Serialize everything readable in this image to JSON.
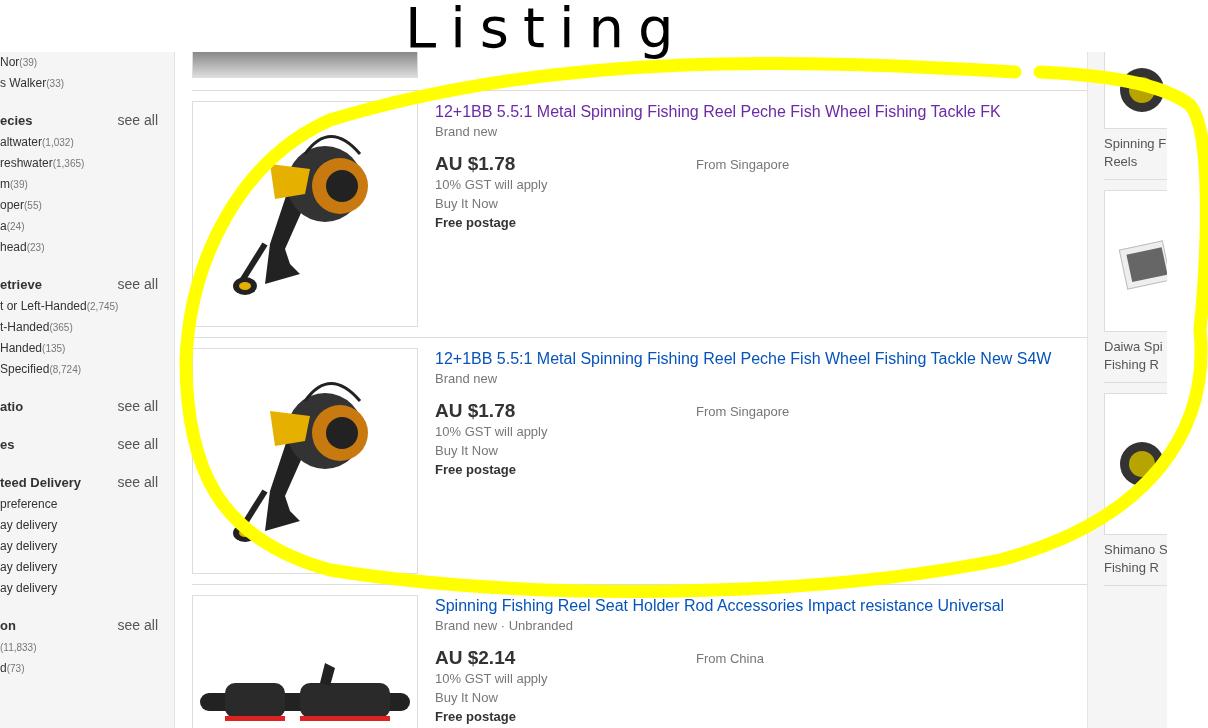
{
  "annotation": {
    "label": "Listing"
  },
  "sidebar": {
    "groups": [
      {
        "items": [
          {
            "name": "Nor",
            "count": "(39)"
          },
          {
            "name": "s Walker",
            "count": "(33)"
          }
        ]
      },
      {
        "heading": "ecies",
        "see_all": "see all",
        "items": [
          {
            "name": "altwater",
            "count": "(1,032)"
          },
          {
            "name": "reshwater",
            "count": "(1,365)"
          },
          {
            "name": "m",
            "count": "(39)"
          },
          {
            "name": "oper",
            "count": "(55)"
          },
          {
            "name": "a",
            "count": "(24)"
          },
          {
            "name": "head",
            "count": "(23)"
          }
        ]
      },
      {
        "heading": "etrieve",
        "see_all": "see all",
        "items": [
          {
            "name": "t or Left-Handed",
            "count": "(2,745)"
          },
          {
            "name": "t-Handed",
            "count": "(365)"
          },
          {
            "name": "Handed",
            "count": "(135)"
          },
          {
            "name": "Specified",
            "count": "(8,724)"
          }
        ]
      },
      {
        "heading": "atio",
        "see_all": "see all"
      },
      {
        "heading": "es",
        "see_all": "see all"
      },
      {
        "heading": "teed Delivery",
        "see_all": "see all",
        "items": [
          {
            "name": "preference"
          },
          {
            "name": "ay delivery"
          },
          {
            "name": "ay delivery"
          },
          {
            "name": "ay delivery"
          },
          {
            "name": "ay delivery"
          }
        ]
      },
      {
        "heading": "on",
        "see_all": "see all",
        "items": [
          {
            "count": "(11,833)"
          },
          {
            "name": "d",
            "count": "(73)"
          }
        ]
      }
    ]
  },
  "listings": [
    {
      "kind": "reel",
      "title": "12+1BB 5.5:1 Metal Spinning Fishing Reel Peche Fish Wheel Fishing Tackle FK",
      "visited": true,
      "condition": "Brand new",
      "price": "AU $1.78",
      "gst": "10% GST will apply",
      "format": "Buy It Now",
      "postage": "Free postage",
      "location": "From Singapore"
    },
    {
      "kind": "reel",
      "title": "12+1BB 5.5:1 Metal Spinning Fishing Reel Peche Fish Wheel Fishing Tackle New S4W",
      "visited": false,
      "condition": "Brand new",
      "price": "AU $1.78",
      "gst": "10% GST will apply",
      "format": "Buy It Now",
      "postage": "Free postage",
      "location": "From Singapore"
    },
    {
      "kind": "holder",
      "title": "Spinning Fishing Reel Seat Holder Rod Accessories Impact resistance Universal",
      "visited": false,
      "condition": "Brand new · Unbranded",
      "price": "AU $2.14",
      "gst": "10% GST will apply",
      "format": "Buy It Now",
      "postage": "Free postage",
      "location": "From China"
    }
  ],
  "related": [
    {
      "kind": "reel",
      "lines": [
        "Spinning F",
        "Reels"
      ]
    },
    {
      "kind": "photos",
      "lines": [
        "Daiwa Spi",
        "Fishing R"
      ]
    },
    {
      "kind": "reel",
      "lines": [
        "Shimano S",
        "Fishing R"
      ]
    }
  ]
}
